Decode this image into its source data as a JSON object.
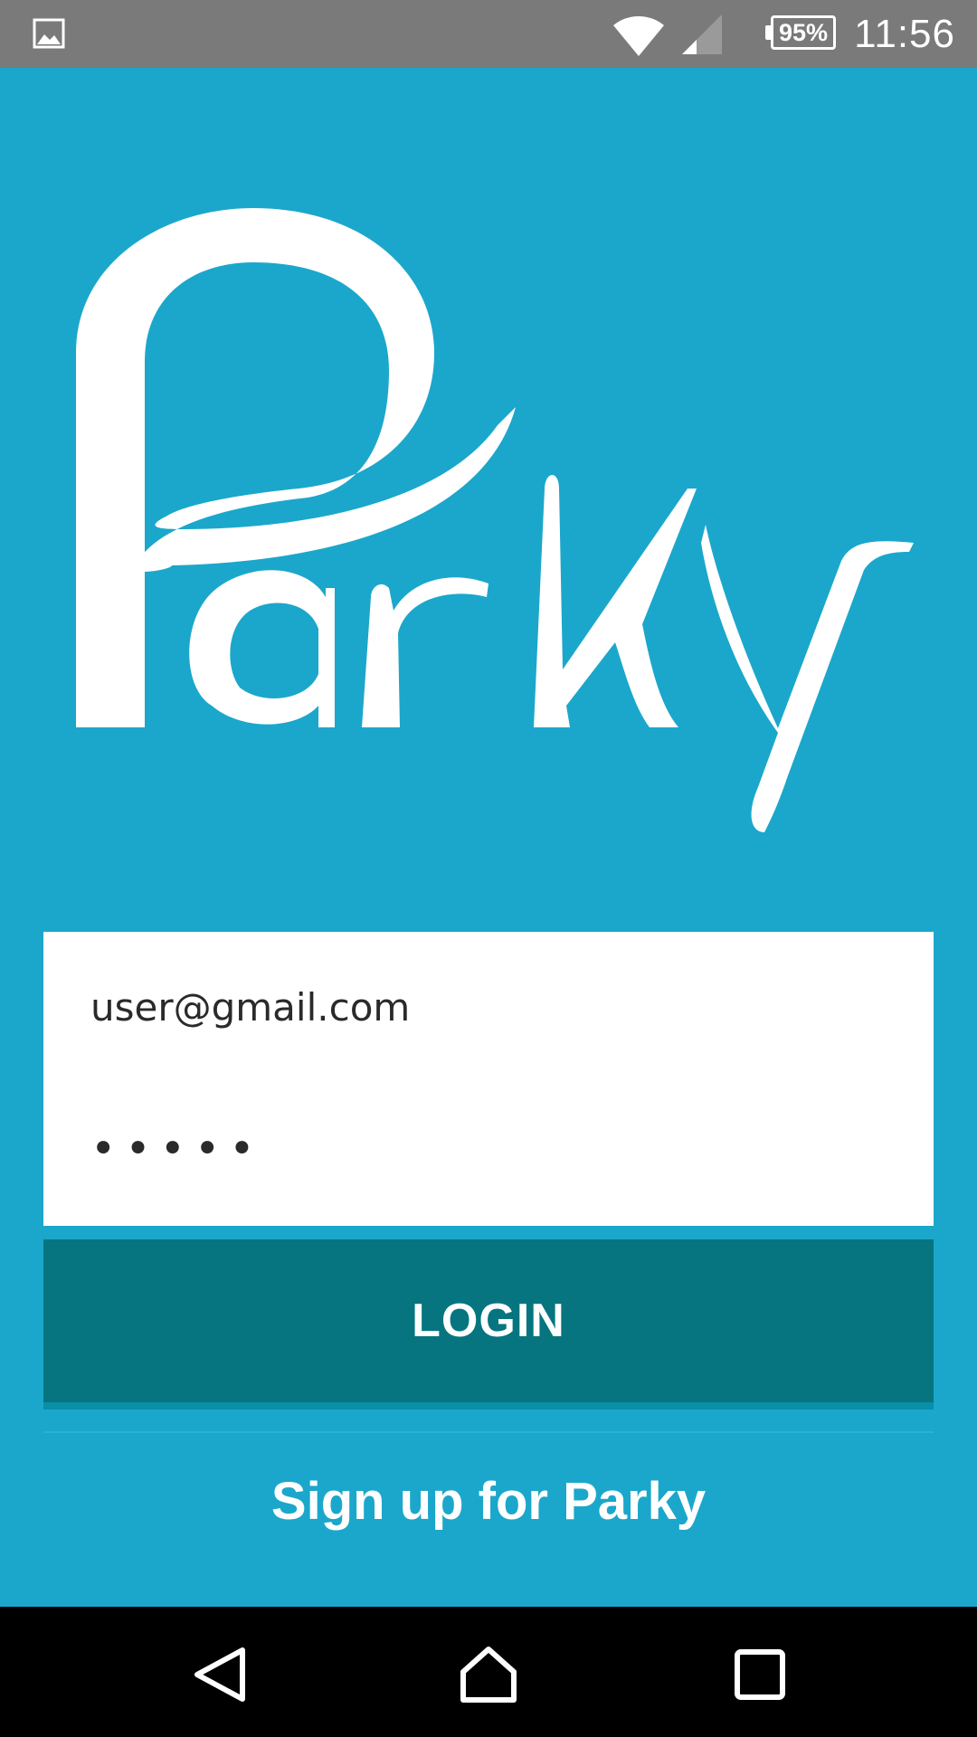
{
  "status_bar": {
    "time": "11:56",
    "battery_percent": "95%",
    "icons": [
      "gallery-icon",
      "wifi-icon",
      "signal-icon",
      "battery-icon"
    ]
  },
  "app": {
    "logo_text": "Parky"
  },
  "form": {
    "email_value": "user@gmail.com",
    "password_value": "•••••"
  },
  "actions": {
    "login_label": "LOGIN",
    "signup_label": "Sign up for Parky"
  },
  "nav_bar": {
    "buttons": [
      "back-icon",
      "home-icon",
      "recents-icon"
    ]
  },
  "colors": {
    "background": "#1ba7cb",
    "login_button": "#06757f",
    "status_bar": "#7a7a7a",
    "nav_bar": "#000000"
  }
}
